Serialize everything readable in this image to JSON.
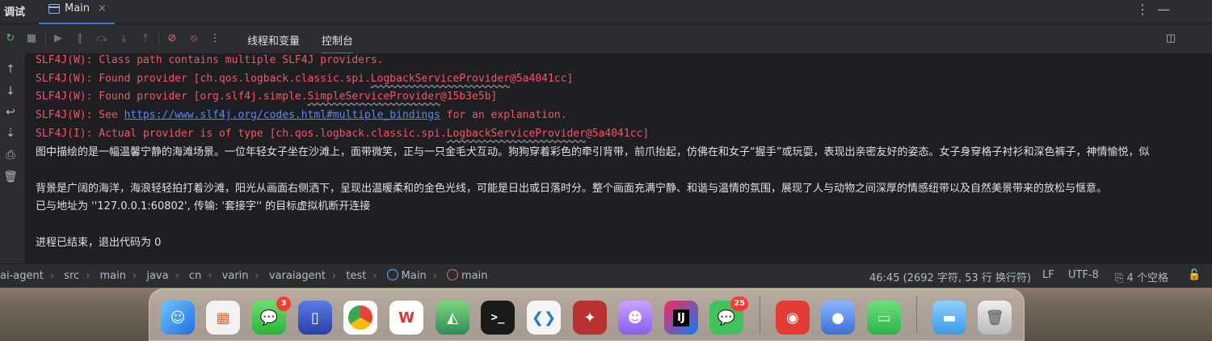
{
  "toolwindow": {
    "title": "调试",
    "tab_label": "Main",
    "close_glyph": "×",
    "more_glyph": "⋮",
    "minimize_glyph": "—"
  },
  "debug_toolbar": {
    "icons": [
      "rerun-icon",
      "stop-icon",
      "resume-icon",
      "pause-icon",
      "step-over-icon",
      "step-into-icon",
      "step-out-icon",
      "view-breakpoints-icon",
      "mute-breakpoints-icon",
      "more-icon"
    ],
    "tabs": [
      {
        "label": "线程和变量",
        "active": false
      },
      {
        "label": "控制台",
        "active": true
      }
    ]
  },
  "console": {
    "lines": [
      {
        "prefix": "SLF4J(W): Class path contains multiple SLF4J providers.",
        "kind": "err"
      },
      {
        "prefix": "SLF4J(W): Found provider [ch.qos.logback.classic.spi.",
        "wavy": "LogbackServiceProvider",
        "suffix": "@5a4041cc]",
        "kind": "err"
      },
      {
        "prefix": "SLF4J(W): Found provider [org.slf4j.simple.",
        "wavy": "SimpleServiceProvider",
        "suffix": "@15b3e5b]",
        "kind": "err"
      },
      {
        "prefix": "SLF4J(W): See ",
        "link": "https://www.slf4j.org/codes.html#multiple_bindings",
        "suffix": " for an explanation.",
        "kind": "err"
      },
      {
        "prefix": "SLF4J(I): Actual provider is of type [ch.qos.logback.classic.spi.",
        "wavy": "LogbackServiceProvider",
        "suffix": "@5a4041cc]",
        "kind": "err"
      },
      {
        "prefix": "图中描绘的是一幅温馨宁静的海滩场景。一位年轻女子坐在沙滩上，面带微笑，正与一只金毛犬互动。狗狗穿着彩色的牵引背带，前爪抬起，仿佛在和女子“握手”或玩耍，表现出亲密友好的姿态。女子身穿格子衬衫和深色裤子，神情愉悦，似",
        "kind": "out"
      },
      {
        "prefix": "",
        "kind": "out"
      },
      {
        "prefix": "背景是广阔的海洋，海浪轻轻拍打着沙滩，阳光从画面右侧洒下，呈现出温暖柔和的金色光线，可能是日出或日落时分。整个画面充满宁静、和谐与温情的氛围，展现了人与动物之间深厚的情感纽带以及自然美景带来的放松与惬意。",
        "kind": "out"
      },
      {
        "prefix": "已与地址为 ''127.0.0.1:60802', 传输: '套接字'' 的目标虚拟机断开连接",
        "kind": "out"
      },
      {
        "prefix": "",
        "kind": "out"
      },
      {
        "prefix": "进程已结束，退出代码为 0",
        "kind": "out"
      }
    ]
  },
  "breadcrumbs": [
    "ai-agent",
    "src",
    "main",
    "java",
    "cn",
    "varin",
    "varaiagent",
    "test",
    "Main",
    "main"
  ],
  "status": {
    "position": "46:45 (2692 字符, 53 行 换行符)",
    "line_separator": "LF",
    "encoding": "UTF-8",
    "indent": "4 个空格"
  },
  "dock": {
    "apps": [
      {
        "name": "finder",
        "badge": ""
      },
      {
        "name": "launchpad",
        "badge": ""
      },
      {
        "name": "messages",
        "badge": "3"
      },
      {
        "name": "simulator",
        "badge": ""
      },
      {
        "name": "chrome",
        "badge": ""
      },
      {
        "name": "wps",
        "badge": ""
      },
      {
        "name": "android-studio",
        "badge": ""
      },
      {
        "name": "terminal",
        "badge": ""
      },
      {
        "name": "vscode",
        "badge": ""
      },
      {
        "name": "app-star",
        "badge": ""
      },
      {
        "name": "app-cat",
        "badge": ""
      },
      {
        "name": "intellij-idea",
        "badge": ""
      },
      {
        "name": "wechat",
        "badge": "25"
      },
      {
        "name": "netease-music",
        "badge": ""
      },
      {
        "name": "app-camera",
        "badge": ""
      },
      {
        "name": "app-chat",
        "badge": ""
      },
      {
        "name": "folder",
        "badge": ""
      },
      {
        "name": "trash",
        "badge": ""
      }
    ],
    "terminal_glyph": ">_",
    "idea_glyph": "IJ"
  },
  "colors": {
    "error_text": "#f75464",
    "link": "#548af7",
    "accent": "#3574f0"
  }
}
